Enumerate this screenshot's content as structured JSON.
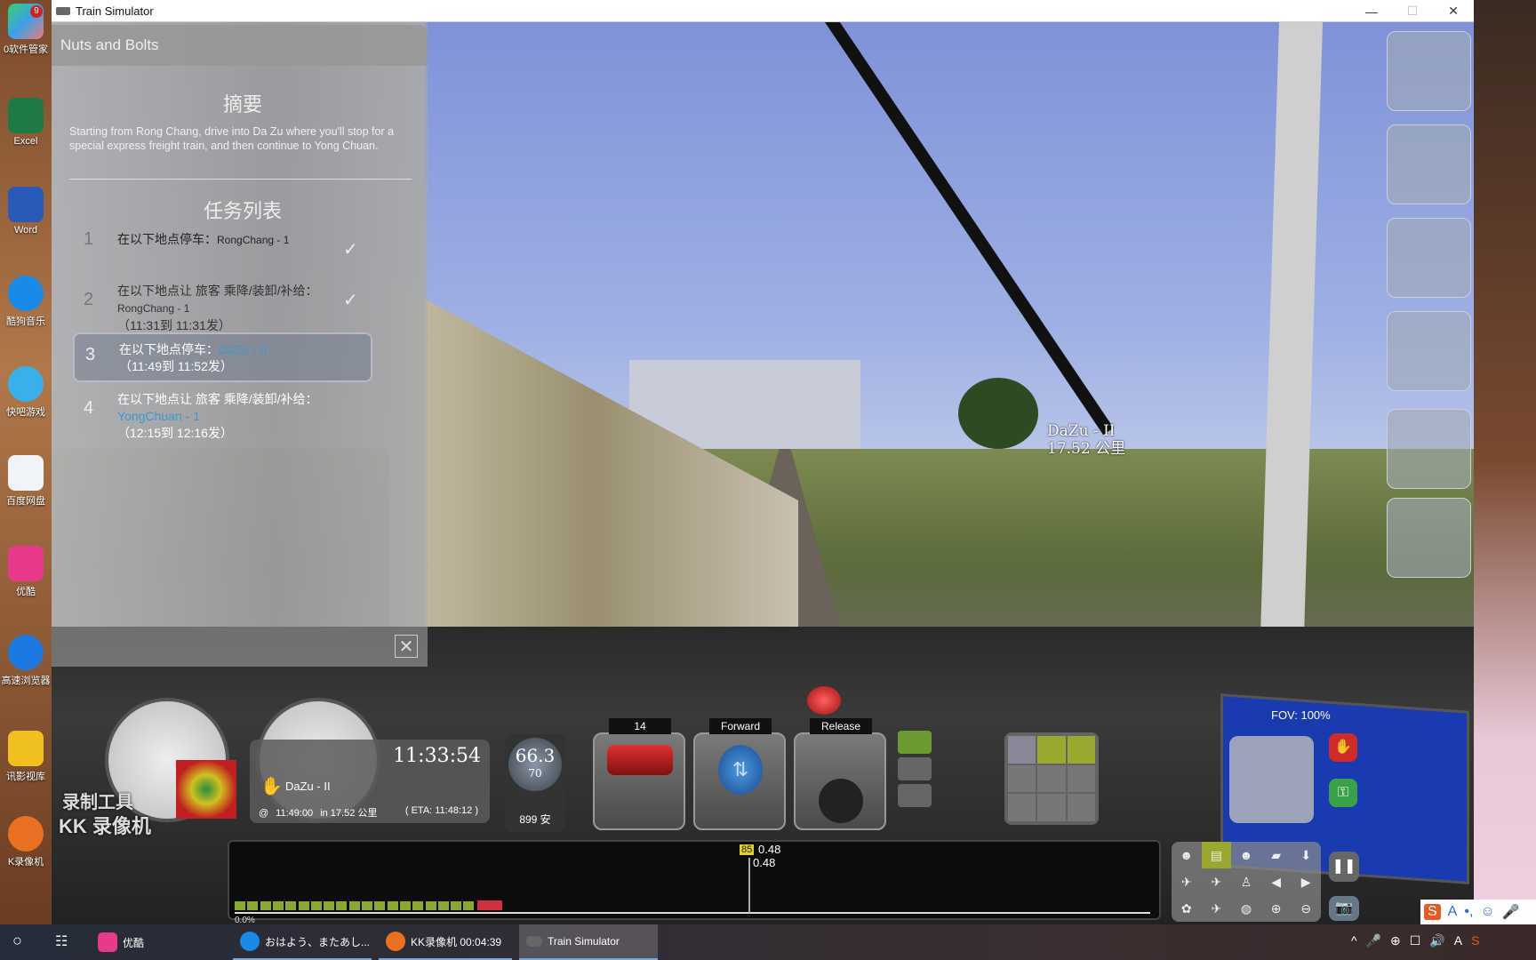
{
  "window": {
    "title": "Train Simulator",
    "min": "—",
    "max": "☐",
    "close": "✕"
  },
  "desktop": {
    "icons": [
      {
        "label": "0软件管家",
        "color": "#3aa0e8"
      },
      {
        "label": "Excel",
        "color": "#1e7a44"
      },
      {
        "label": "Word",
        "color": "#2a5ab8"
      },
      {
        "label": "酷狗音乐",
        "color": "#1a8ae8"
      },
      {
        "label": "快吧游戏",
        "color": "#3ab0e8"
      },
      {
        "label": "百度网盘",
        "color": "#f0f4f8"
      },
      {
        "label": "优酷",
        "color": "#e83a8a"
      },
      {
        "label": "高速浏览器",
        "color": "#1a7ae0"
      },
      {
        "label": "讯影视库",
        "color": "#f0c020"
      },
      {
        "label": "K录像机",
        "color": "#e87020"
      }
    ],
    "badge": "9"
  },
  "panel": {
    "title": "Nuts and Bolts",
    "summary_heading": "摘要",
    "summary": "Starting from Rong Chang, drive into Da Zu where you'll stop for a special express freight train, and then continue to Yong Chuan.",
    "tasks_heading": "任务列表",
    "tasks": [
      {
        "num": "1",
        "line1": "在以下地点停车：",
        "loc": "RongChang - 1",
        "line2": "",
        "done": true
      },
      {
        "num": "2",
        "line1": "在以下地点让 旅客 乘降/装卸/补给：",
        "loc": "RongChang - 1",
        "line2": "（11:31到 11:31发）",
        "done": true
      },
      {
        "num": "3",
        "line1": "在以下地点停车：",
        "loc": "DaZu - II",
        "line2": "（11:49到 11:52发）",
        "done": false,
        "active": true
      },
      {
        "num": "4",
        "line1": "在以下地点让 旅客 乘降/装卸/补给：",
        "loc": "YongChuan - 1",
        "line2": "（12:15到 12:16发）",
        "done": false
      }
    ],
    "check": "✓",
    "close": "✕"
  },
  "scene": {
    "marker_name": "DaZu - II",
    "marker_dist": "17.52 公里"
  },
  "hud": {
    "clock": "11:33:54",
    "next_signal": "DaZu - II",
    "at": "@",
    "arrive": "11:49:00",
    "distance": "in 17.52 公里",
    "eta": "( ETA: 11:48:12 )",
    "speed": "66.3",
    "speed_limit": "70",
    "amps": "899 安",
    "throttle_label": "14",
    "reverser_label": "Forward",
    "brake_label": "Release",
    "limit_marker": "85",
    "track_val1": "0.48",
    "track_val2": "0.48",
    "progress": "0.0%",
    "fov": "FOV: 100%",
    "watermark1": "录制工具",
    "watermark2": "KK 录像机"
  },
  "taskbar": {
    "items": [
      {
        "label": "优酷",
        "color": "#e83a8a"
      },
      {
        "label": "おはよう、またあし...",
        "color": "#1a8ae8"
      },
      {
        "label": "KK录像机 00:04:39",
        "color": "#e87020"
      },
      {
        "label": "Train Simulator",
        "color": "#666"
      }
    ],
    "tray": [
      "^",
      "🎤",
      "⊕",
      "☐",
      "🔊",
      "A",
      "S"
    ]
  }
}
